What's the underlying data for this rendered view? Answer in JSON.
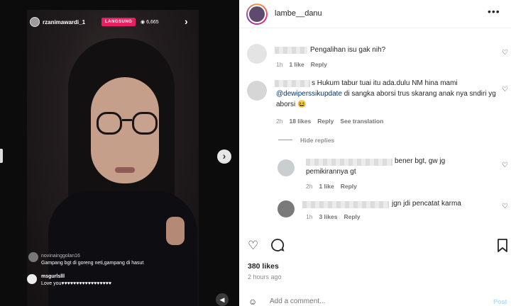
{
  "video": {
    "username": "rzanimawardi_1",
    "live_label": "LANGSUNG",
    "viewers": "6,665",
    "live_comments": [
      {
        "name": "novinainggolan16",
        "text": "Gampang bgt di goreng neti,gampang di hasut"
      },
      {
        "name": "msgurlslll",
        "text": "Love you♥♥♥♥♥♥♥♥♥♥♥♥♥♥♥♥♥"
      }
    ]
  },
  "post": {
    "author": "lambe__danu",
    "comments": [
      {
        "text": "Pengalihan isu gak nih?",
        "time": "1h",
        "likes": "1 like",
        "reply": "Reply"
      },
      {
        "text_pre": "s Hukum tabur tuai itu ada.dulu NM hina mami",
        "mention": "@dewiperssikupdate",
        "text_post": " di sangka aborsi trus skarang anak nya sndiri yg aborsi 😆",
        "time": "2h",
        "likes": "18 likes",
        "reply": "Reply",
        "translate": "See translation"
      }
    ],
    "hide_replies": "Hide replies",
    "replies": [
      {
        "text1": "bener bgt, gw jg",
        "text2": "pemikirannya gt",
        "time": "2h",
        "likes": "1 like",
        "reply": "Reply"
      },
      {
        "text1": "jgn jdi pencatat karma",
        "time": "1h",
        "likes": "3 likes",
        "reply": "Reply"
      }
    ],
    "likes_count": "380 likes",
    "time_ago": "2 hours ago",
    "comment_placeholder": "Add a comment...",
    "post_label": "Post"
  }
}
